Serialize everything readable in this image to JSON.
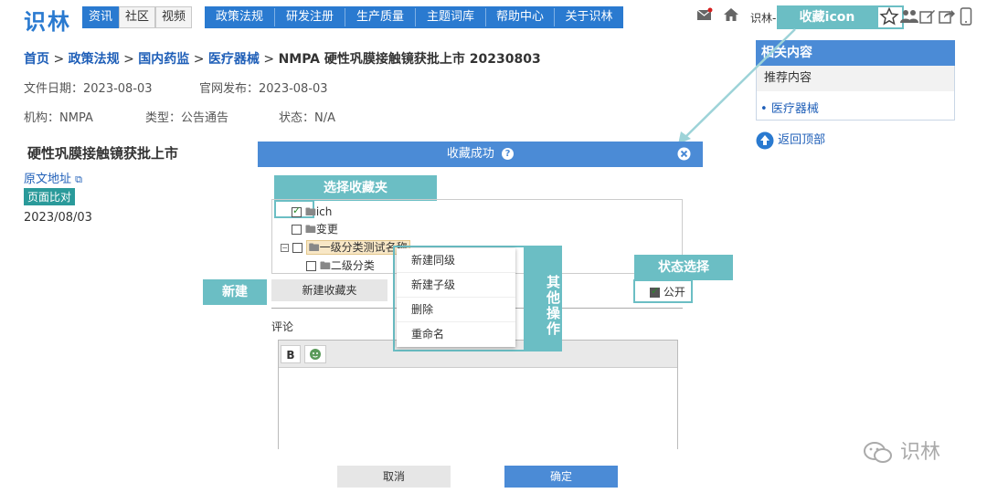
{
  "header": {
    "logo": "识林",
    "mode_tabs": [
      "资讯",
      "社区",
      "视频"
    ],
    "nav_items": [
      "政策法规",
      "研发注册",
      "生产质量",
      "主题词库",
      "帮助中心",
      "关于识林"
    ],
    "user_label": "识林-",
    "favorite_icon_callout": "收藏icon"
  },
  "breadcrumb": {
    "items": [
      "首页",
      "政策法规",
      "国内药监",
      "医疗器械"
    ],
    "separator": ">",
    "current": "NMPA 硬性巩膜接触镜获批上市 20230803"
  },
  "meta": {
    "file_date": "文件日期：2023-08-03",
    "publish_date": "官网发布：2023-08-03",
    "agency": "机构：NMPA",
    "type": "类型：公告通告",
    "status": "状态：N/A"
  },
  "article": {
    "title": "硬性巩膜接触镜获批上市",
    "source_link": "原文地址",
    "compare_badge": "页面比对",
    "date": "2023/08/03"
  },
  "side_panel": {
    "title": "相关内容",
    "recommend": "推荐内容",
    "link": "医疗器械",
    "back_to_top": "返回顶部"
  },
  "dialog": {
    "title": "收藏成功",
    "help_icon": "?",
    "folder_callout": "选择收藏夹",
    "folders": [
      {
        "label": "ich",
        "checked": true
      },
      {
        "label": "变更",
        "checked": false
      },
      {
        "label": "一级分类测试名称",
        "checked": false
      },
      {
        "label": "二级分类",
        "checked": false
      }
    ],
    "new_callout": "新建",
    "new_folder_button": "新建收藏夹",
    "status_callout": "状态选择",
    "public_label": "公开",
    "comment_label": "评论",
    "bold_button": "B",
    "cancel_button": "取消",
    "confirm_button": "确定"
  },
  "context_menu": {
    "items": [
      "新建同级",
      "新建子级",
      "删除",
      "重命名"
    ],
    "callout": "其他操作"
  },
  "watermark": "识林",
  "colors": {
    "brand_blue": "#2a7ad0",
    "dialog_blue": "#4b8bd6",
    "callout_teal": "#6bbec4",
    "link_blue": "#1f5fb8"
  }
}
